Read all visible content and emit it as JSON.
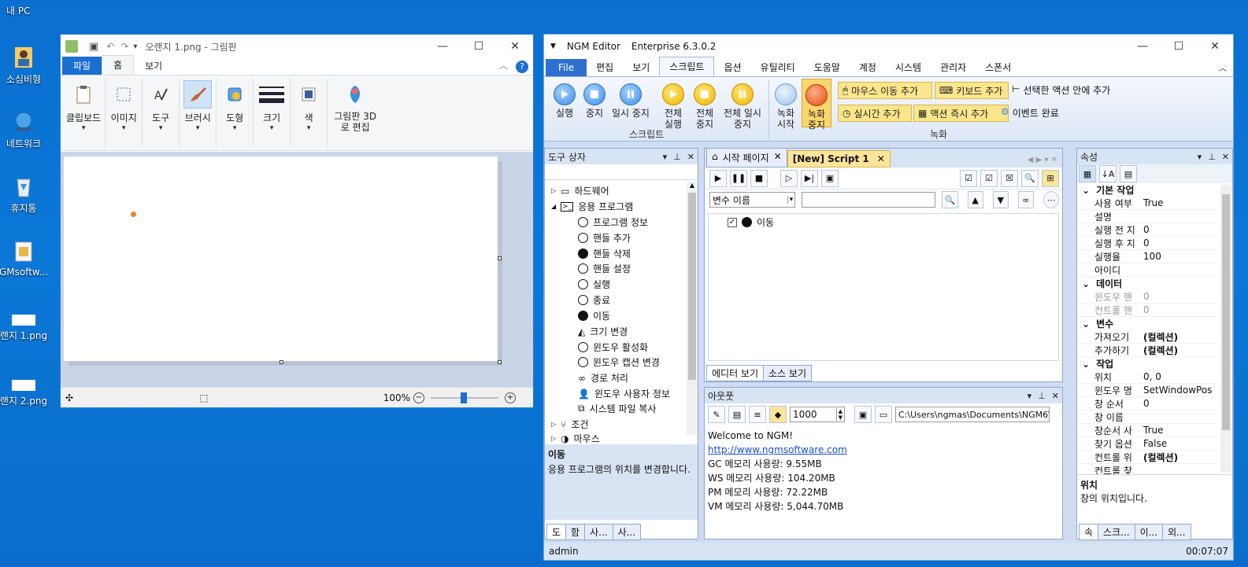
{
  "desktop": {
    "title": "내 PC",
    "icons": [
      {
        "label": "소심비형"
      },
      {
        "label": "네트워크"
      },
      {
        "label": "휴지통"
      },
      {
        "label": "GMsoftw..."
      },
      {
        "label": "랜지 1.png"
      },
      {
        "label": "랜지 2.png"
      }
    ]
  },
  "paint": {
    "title": "오랜지 1.png - 그림판",
    "tabs": [
      "파일",
      "홈",
      "보기"
    ],
    "groups": [
      "클립보드",
      "이미지",
      "도구",
      "브러시",
      "도형",
      "크기",
      "색",
      "그림판 3D로 편집"
    ],
    "zoom": "100%",
    "colors": {
      "file_tab": "#1c6ed1",
      "dot": "#e8862b"
    }
  },
  "ngm": {
    "title": "NGM Editor",
    "edition": "Enterprise 6.3.0.2",
    "menu": [
      "File",
      "편집",
      "보기",
      "스크립트",
      "옵션",
      "유틸리티",
      "도움말",
      "계정",
      "시스템",
      "관리자",
      "스폰서"
    ],
    "ribbon": {
      "script_buttons": [
        "실행",
        "중지",
        "일시 중지"
      ],
      "all_buttons": [
        "전체 실행",
        "전체 중지",
        "전체 일시 중지"
      ],
      "record_buttons": [
        "녹화 시작",
        "녹화 중지"
      ],
      "script_group": "스크립트",
      "record_group": "녹화",
      "pills": [
        "마우스 이동 추가",
        "키보드 추가",
        "실시간 추가",
        "액션 즉시 추가"
      ],
      "links": [
        "선택한 액션 안에 추가",
        "이벤트 완료"
      ]
    },
    "toolbox": {
      "title": "도구 상자",
      "items": [
        {
          "label": "하드웨어"
        },
        {
          "label": "응용 프로그램"
        },
        {
          "label": "프로그램 정보"
        },
        {
          "label": "핸들 추가"
        },
        {
          "label": "핸들 삭제"
        },
        {
          "label": "핸들 설정"
        },
        {
          "label": "실행"
        },
        {
          "label": "종료"
        },
        {
          "label": "이동"
        },
        {
          "label": "크기 변경"
        },
        {
          "label": "윈도우 활성화"
        },
        {
          "label": "윈도우 캡션 변경"
        },
        {
          "label": "경로 처리"
        },
        {
          "label": "윈도우 사용자 정보"
        },
        {
          "label": "시스템 파일 복사"
        },
        {
          "label": "조건"
        },
        {
          "label": "마우스"
        }
      ],
      "desc_title": "이동",
      "desc_text": "응용 프로그램의 위치를 변경합니다.",
      "bottom_tabs": [
        "도",
        "함",
        "사...",
        "사..."
      ]
    },
    "editor": {
      "tabs": [
        "시작 페이지",
        "[New] Script 1"
      ],
      "var_select": "변수 이름",
      "action": "이동",
      "bottom_tabs": [
        "에디터 보기",
        "소스 보기"
      ]
    },
    "output": {
      "title": "아웃풋",
      "delay": "1000",
      "path": "C:\\Users\\ngmas\\Documents\\NGM6\\",
      "lines": [
        "Welcome to NGM!",
        "http://www.ngmsoftware.com",
        "GC 메모리 사용량: 9.55MB",
        "WS 메모리 사용량: 104.20MB",
        "PM 메모리 사용량: 72.22MB",
        "VM 메모리 사용량: 5,044.70MB"
      ]
    },
    "properties": {
      "title": "속성",
      "rows": [
        {
          "type": "cat",
          "k": "기본 작업"
        },
        {
          "type": "row",
          "k": "사용 여부",
          "v": "True"
        },
        {
          "type": "row",
          "k": "설명",
          "v": ""
        },
        {
          "type": "row",
          "k": "실행 전 지",
          "v": "0"
        },
        {
          "type": "row",
          "k": "실행 후 지",
          "v": "0"
        },
        {
          "type": "row",
          "k": "실행율",
          "v": "100"
        },
        {
          "type": "row",
          "k": "아이디",
          "v": ""
        },
        {
          "type": "cat",
          "k": "데이터"
        },
        {
          "type": "row",
          "k": "윈도우 핸",
          "v": "0"
        },
        {
          "type": "row",
          "k": "컨트롤 핸",
          "v": "0"
        },
        {
          "type": "cat",
          "k": "변수"
        },
        {
          "type": "row",
          "k": "가져오기",
          "v": "(컬렉션)"
        },
        {
          "type": "row",
          "k": "추가하기",
          "v": "(컬렉션)"
        },
        {
          "type": "cat",
          "k": "작업"
        },
        {
          "type": "row",
          "k": "위치",
          "v": "0, 0"
        },
        {
          "type": "row",
          "k": "윈도우 명",
          "v": "SetWindowPos"
        },
        {
          "type": "row",
          "k": "창 순서",
          "v": "0"
        },
        {
          "type": "row",
          "k": "창 이름",
          "v": ""
        },
        {
          "type": "row",
          "k": "창순서 사",
          "v": "True"
        },
        {
          "type": "row",
          "k": "찾기 옵션",
          "v": "False"
        },
        {
          "type": "row",
          "k": "컨트롤 위",
          "v": "(컬렉션)"
        },
        {
          "type": "row",
          "k": "컨트롤 찾",
          "v": ""
        }
      ],
      "desc_title": "위치",
      "desc_text": "창의 위치입니다.",
      "bottom_tabs": [
        "속",
        "스크...",
        "이...",
        "외..."
      ]
    },
    "status": {
      "user": "admin",
      "time": "00:07:07"
    }
  }
}
